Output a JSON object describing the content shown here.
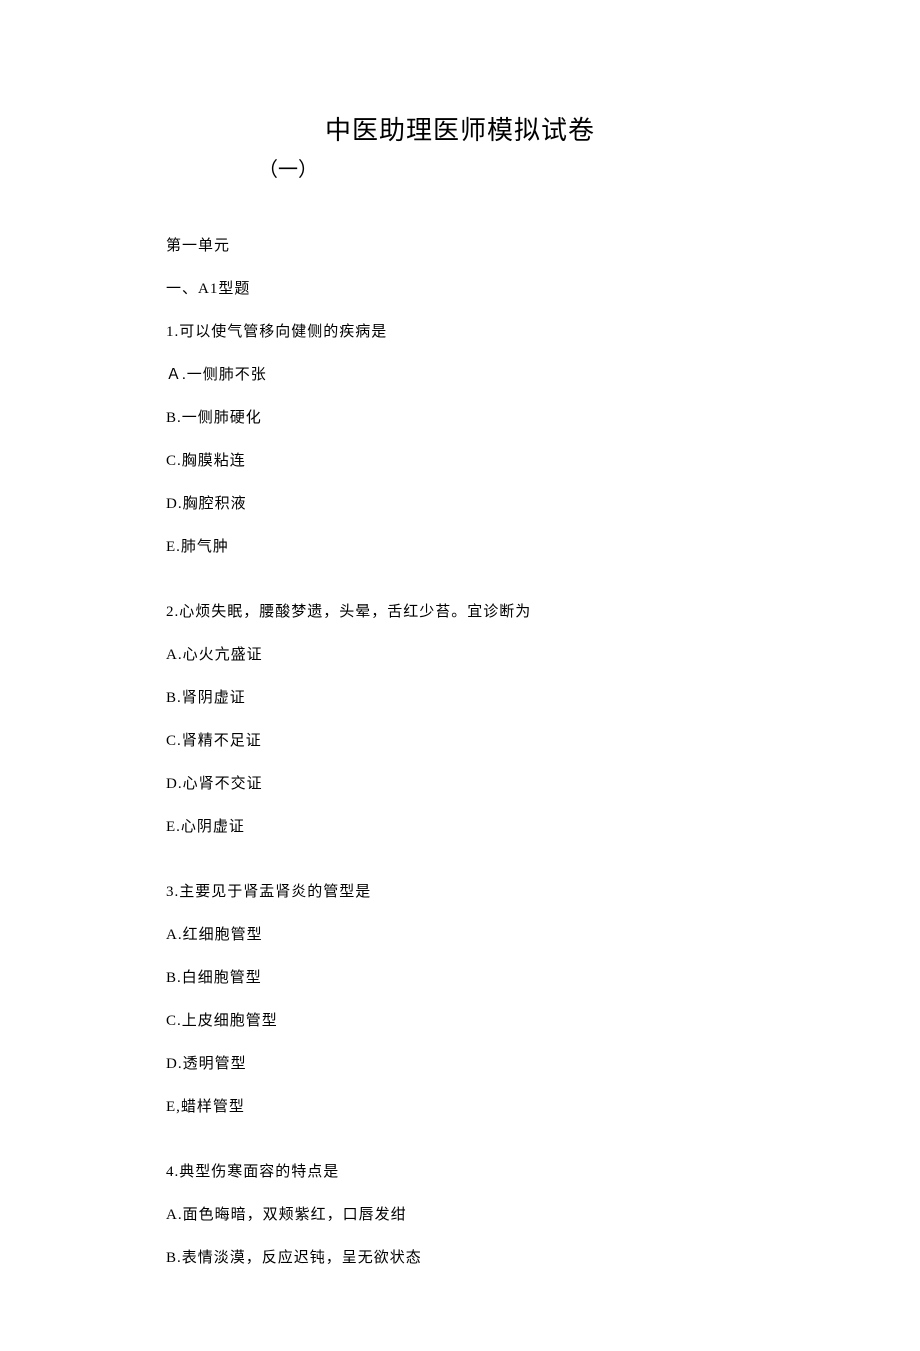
{
  "title": "中医助理医师模拟试卷",
  "subtitle": "（一）",
  "unit_heading": "第一单元",
  "section_heading": "一、A1型题",
  "questions": [
    {
      "stem": "1.可以使气管移向健侧的疾病是",
      "options": [
        "Ａ.一侧肺不张",
        "B.一侧肺硬化",
        "C.胸膜粘连",
        "D.胸腔积液",
        "E.肺气肿"
      ]
    },
    {
      "stem": "2.心烦失眠，腰酸梦遗，头晕，舌红少苔。宜诊断为",
      "options": [
        "A.心火亢盛证",
        "B.肾阴虚证",
        "C.肾精不足证",
        "D.心肾不交证",
        "E.心阴虚证"
      ]
    },
    {
      "stem": "3.主要见于肾盂肾炎的管型是",
      "options": [
        "A.红细胞管型",
        "B.白细胞管型",
        "C.上皮细胞管型",
        "D.透明管型",
        "E,蜡样管型"
      ]
    },
    {
      "stem": "4.典型伤寒面容的特点是",
      "options": [
        "A.面色晦暗，双颊紫红，口唇发绀",
        "B.表情淡漠，反应迟钝，呈无欲状态"
      ]
    }
  ]
}
